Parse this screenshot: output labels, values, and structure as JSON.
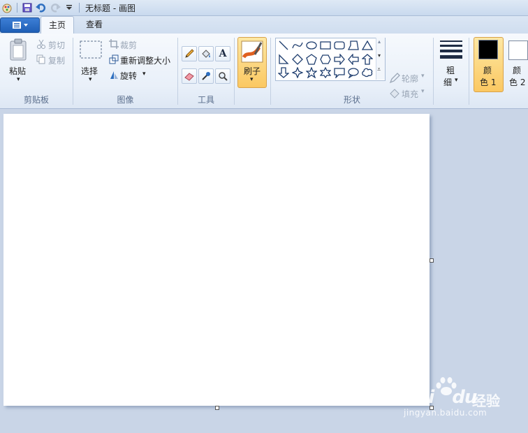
{
  "window": {
    "title": "无标题 - 画图"
  },
  "tabs": [
    {
      "label": "主页",
      "active": true
    },
    {
      "label": "查看",
      "active": false
    }
  ],
  "clipboard": {
    "paste_label": "粘贴",
    "cut_label": "剪切",
    "copy_label": "复制",
    "group_label": "剪贴板"
  },
  "image": {
    "select_label": "选择",
    "crop_label": "裁剪",
    "resize_label": "重新调整大小",
    "rotate_label": "旋转",
    "group_label": "图像"
  },
  "tools": {
    "group_label": "工具",
    "text_glyph": "A"
  },
  "brush": {
    "label": "刷子"
  },
  "shapes": {
    "group_label": "形状",
    "outline_label": "轮廓",
    "fill_label": "填充"
  },
  "size": {
    "label_line1": "粗",
    "label_line2": "细"
  },
  "colors": {
    "color1_line1": "颜",
    "color1_line2": "色 1",
    "color2_line1": "颜",
    "color2_line2": "色 2",
    "color1_value": "#000000",
    "color2_value": "#ffffff"
  },
  "watermark": {
    "brand": "Bai",
    "brand2": "du",
    "cn": "经验",
    "url": "jingyan.baidu.com"
  }
}
